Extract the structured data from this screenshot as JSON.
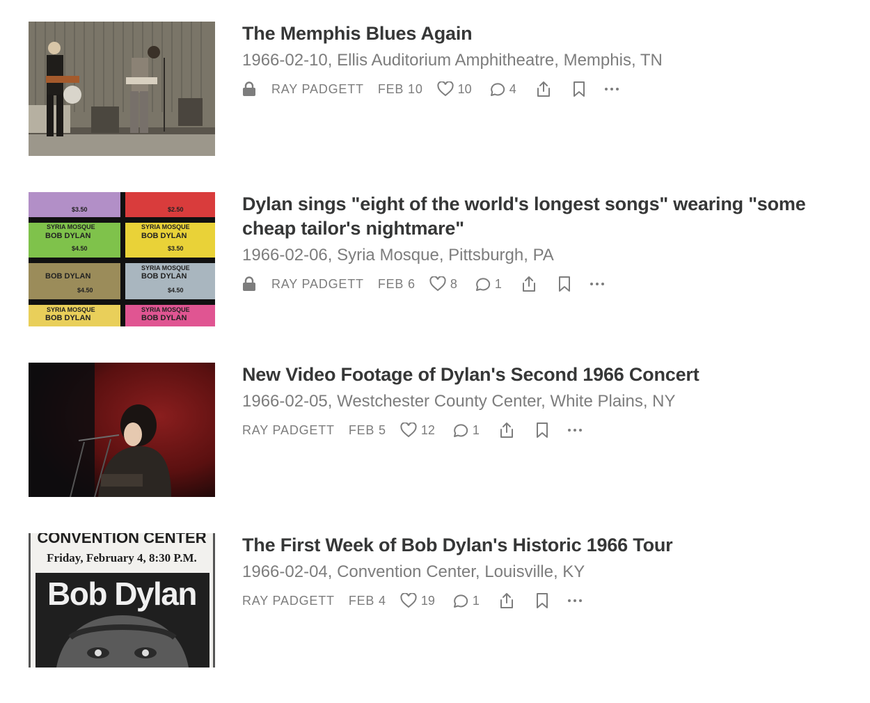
{
  "posts": [
    {
      "title": "The Memphis Blues Again",
      "subtitle": "1966-02-10, Ellis Auditorium Amphitheatre, Memphis, TN",
      "author": "RAY PADGETT",
      "date": "FEB 10",
      "likes": "10",
      "comments": "4",
      "locked": true
    },
    {
      "title": "Dylan sings \"eight of the world's longest songs\" wearing \"some cheap tailor's nightmare\"",
      "subtitle": "1966-02-06, Syria Mosque, Pittsburgh, PA",
      "author": "RAY PADGETT",
      "date": "FEB 6",
      "likes": "8",
      "comments": "1",
      "locked": true,
      "thumbnail_text": {
        "venue": "SYRIA MOSQUE",
        "artist": "BOB DYLAN",
        "prices": [
          "$3.50",
          "$4.50",
          "$3.50",
          "$4.50",
          "$2.50"
        ]
      }
    },
    {
      "title": "New Video Footage of Dylan's Second 1966 Concert",
      "subtitle": "1966-02-05, Westchester County Center, White Plains, NY",
      "author": "RAY PADGETT",
      "date": "FEB 5",
      "likes": "12",
      "comments": "1",
      "locked": false
    },
    {
      "title": "The First Week of Bob Dylan's Historic 1966 Tour",
      "subtitle": "1966-02-04, Convention Center, Louisville, KY",
      "author": "RAY PADGETT",
      "date": "FEB 4",
      "likes": "19",
      "comments": "1",
      "locked": false,
      "thumbnail_text": {
        "header": "CONVENTION CENTER",
        "when": "Friday, February 4, 8:30 P.M.",
        "name": "Bob Dylan"
      }
    }
  ],
  "colors": {
    "title": "#363737",
    "meta": "#7d7d7d",
    "background": "#ffffff"
  },
  "icons": [
    "lock-icon",
    "heart-icon",
    "comment-icon",
    "share-icon",
    "bookmark-icon",
    "more-icon"
  ]
}
